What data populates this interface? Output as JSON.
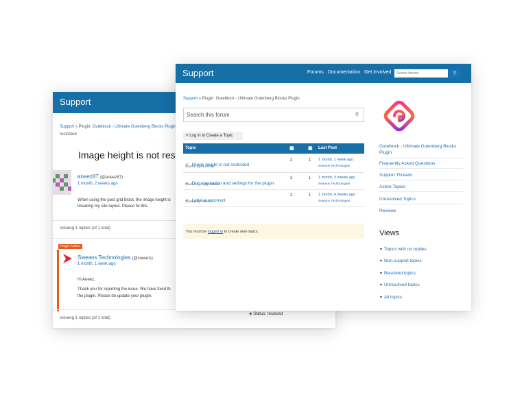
{
  "back": {
    "header_title": "Support",
    "breadcrumb": {
      "support": "Support",
      "sep1": " » Plugin: ",
      "plugin": "Guteblock - Ultimate Gutenberg Blocks Plugin",
      "sep2": " »",
      "tail": "restricted"
    },
    "topic_title": "Image height is not restricted",
    "op": {
      "name": "aneez87",
      "handle": "(@aneez87)",
      "time": "1 month, 2 weeks ago",
      "body_line1": "When using the post grid block, the image height is",
      "body_line2": "breaking my site layout. Please fix this."
    },
    "viewing1": "Viewing 1 replies (of 1 total)",
    "reply": {
      "badge": "Plugin Author",
      "name": "Sweans Technologies",
      "handle": "(@sweans)",
      "time": "1 month, 1 week ago",
      "greeting": "Hi Aneez,",
      "body_line1": "Thank you for reporting the issue. We have fixed th",
      "body_line2": "the plugin. Please do update your plugin."
    },
    "viewing2": "Viewing 1 replies (of 1 total)",
    "status": "Status: resolved"
  },
  "front": {
    "header_title": "Support",
    "nav": [
      "Forums",
      "Documentation",
      "Get Involved"
    ],
    "search_placeholder": "Search forums",
    "breadcrumb": {
      "support": "Support",
      "rest": " » Plugin: Guteblock - Ultimate Gutenberg Blocks Plugin"
    },
    "forum_search": "Search this forum",
    "new_topic": "Log in to Create a Topic",
    "table": {
      "headers": {
        "topic": "Topic",
        "last_post": "Last Post"
      },
      "rows": [
        {
          "title": "Image height is not restricted",
          "started_label": "Started by: ",
          "author": "aneez87",
          "voices": "2",
          "replies": "1",
          "last_time": "1 month, 1 week ago",
          "last_by": "Sweans Technologies"
        },
        {
          "title": "Documentation and settings for the plugin",
          "started_label": "Started by: ",
          "author": "Ajay Aravind",
          "voices": "2",
          "replies": "1",
          "last_time": "1 month, 3 weeks ago",
          "last_by": "Sweans Technologies"
        },
        {
          "title": "Label is incorrect",
          "started_label": "Started by: ",
          "author": "WPGirl",
          "voices": "2",
          "replies": "1",
          "last_time": "1 month, 4 weeks ago",
          "last_by": "Sweans Technologies"
        }
      ]
    },
    "notice": {
      "prefix": "You must be ",
      "link": "logged in",
      "suffix": " to create new topics."
    },
    "sidebar": {
      "plugin_title_line1": "Guteblock - Ultimate Gutenberg Blocks",
      "plugin_title_line2": "Plugin",
      "links": [
        "Frequently Asked Questions",
        "Support Threads",
        "Active Topics",
        "Unresolved Topics",
        "Reviews"
      ],
      "views_heading": "Views",
      "views": [
        "Topics with no replies",
        "Non-support topics",
        "Resolved topics",
        "Unresolved topics",
        "All topics"
      ]
    },
    "colors": {
      "header": "#176fa8",
      "link": "#1a6cb8",
      "author_badge": "#e65b1f",
      "logo_start": "#ff2d8a",
      "logo_end": "#8a2be2"
    }
  }
}
